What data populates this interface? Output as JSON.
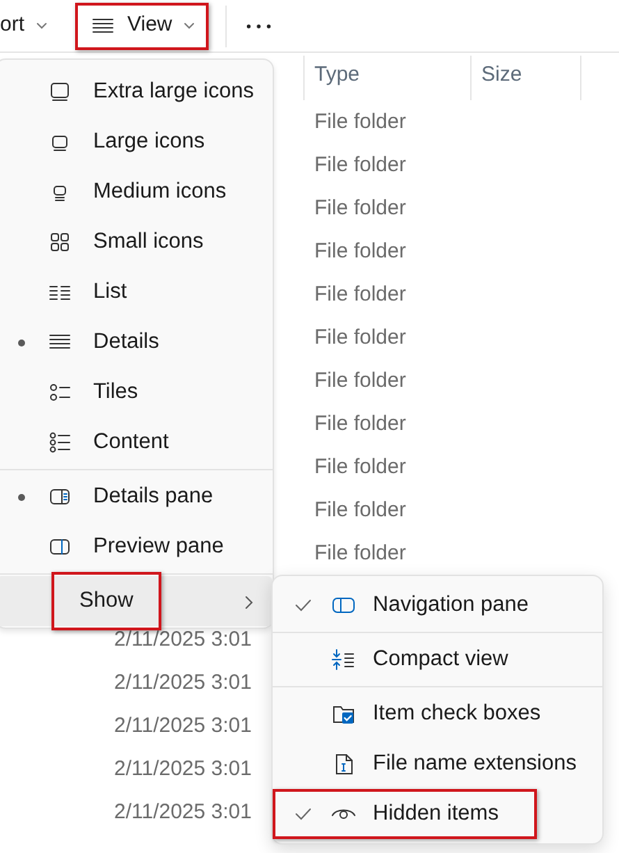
{
  "toolbar": {
    "sort_button": {
      "label": "ort"
    },
    "view_button": {
      "label": "View",
      "highlighted": true
    }
  },
  "table": {
    "columns": [
      "Type",
      "Size"
    ],
    "rows": [
      {
        "type": "File folder"
      },
      {
        "type": "File folder"
      },
      {
        "type": "File folder"
      },
      {
        "type": "File folder"
      },
      {
        "type": "File folder"
      },
      {
        "type": "File folder"
      },
      {
        "type": "File folder"
      },
      {
        "type": "File folder"
      },
      {
        "type": "File folder"
      },
      {
        "type": "File folder"
      },
      {
        "type": "File folder"
      }
    ],
    "rows_below_menu": [
      {
        "date_modified": "2/11/2025 3:01"
      },
      {
        "date_modified": "2/11/2025 3:01"
      },
      {
        "date_modified": "2/11/2025 3:01"
      },
      {
        "date_modified": "2/11/2025 3:01"
      },
      {
        "date_modified": "2/11/2025 3:01"
      }
    ]
  },
  "view_menu": {
    "groups": [
      [
        {
          "label": "Extra large icons",
          "selected": false
        },
        {
          "label": "Large icons",
          "selected": false
        },
        {
          "label": "Medium icons",
          "selected": false
        },
        {
          "label": "Small icons",
          "selected": false
        },
        {
          "label": "List",
          "selected": false
        },
        {
          "label": "Details",
          "selected": true
        },
        {
          "label": "Tiles",
          "selected": false
        },
        {
          "label": "Content",
          "selected": false
        }
      ],
      [
        {
          "label": "Details pane",
          "selected": true
        },
        {
          "label": "Preview pane",
          "selected": false
        }
      ]
    ],
    "show_item": {
      "label": "Show",
      "highlighted": true,
      "expanded": true
    }
  },
  "show_submenu": {
    "groups": [
      [
        {
          "label": "Navigation pane",
          "checked": true,
          "highlighted": false
        }
      ],
      [
        {
          "label": "Compact view",
          "checked": false,
          "highlighted": false
        }
      ],
      [
        {
          "label": "Item check boxes",
          "checked": false,
          "highlighted": false
        },
        {
          "label": "File name extensions",
          "checked": false,
          "highlighted": false
        },
        {
          "label": "Hidden items",
          "checked": true,
          "highlighted": true
        }
      ]
    ]
  }
}
